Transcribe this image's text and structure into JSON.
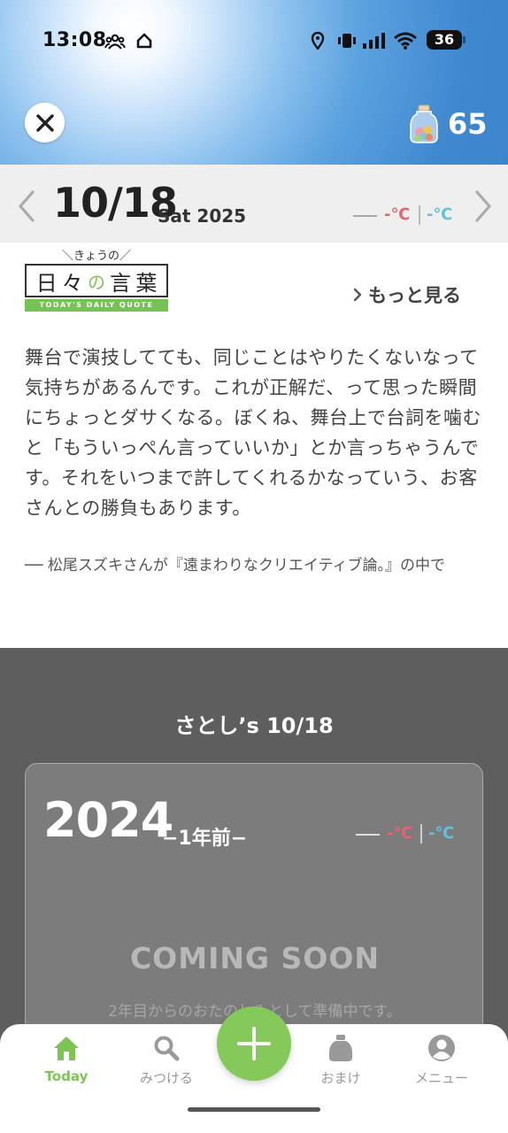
{
  "status_bar": {
    "time": "13:08",
    "battery": "36"
  },
  "header": {
    "points": "65",
    "icons": [
      "close-icon",
      "jar-icon"
    ]
  },
  "date_bar": {
    "date": "10/18",
    "weekday_year": "Sat 2025",
    "temp_high": "-℃",
    "temp_low": "-℃"
  },
  "quote": {
    "logo_sub": "＼きょうの／",
    "logo_chars": [
      "日",
      "々",
      "の",
      "言",
      "葉"
    ],
    "logo_tagline": "TODAY'S DAILY QUOTE",
    "more_label": "もっと見る",
    "body": "舞台で演技してても、同じことはやりたくないなって気持ちがあるんです。これが正解だ、って思った瞬間にちょっとダサくなる。ぼくね、舞台上で台詞を噛むと「もういっぺん言っていいか」とか言っちゃうんです。それをいつまで許してくれるかなっていう、お客さんとの勝負もあります。",
    "source": "── 松尾スズキさんが『遠まわりなクリエイティブ論。』の中で"
  },
  "memory": {
    "title": "さとし’s 10/18",
    "year": "2024",
    "ago": "−1年前−",
    "temp_high": "-℃",
    "temp_low": "-℃",
    "coming_soon": "COMING SOON",
    "coming_sub": "2年目からのおたのしみとして準備中です。"
  },
  "nav": {
    "items": [
      {
        "label": "Today",
        "icon": "home-icon"
      },
      {
        "label": "みつける",
        "icon": "search-icon"
      },
      {
        "label": "おまけ",
        "icon": "jar-icon"
      },
      {
        "label": "メニュー",
        "icon": "person-icon"
      }
    ],
    "add_icon": "plus-icon"
  },
  "colors": {
    "accent": "#7cc553",
    "temp_high": "#e8636b",
    "temp_low": "#5fc3dc",
    "gray_bg": "#5e5e5e"
  }
}
